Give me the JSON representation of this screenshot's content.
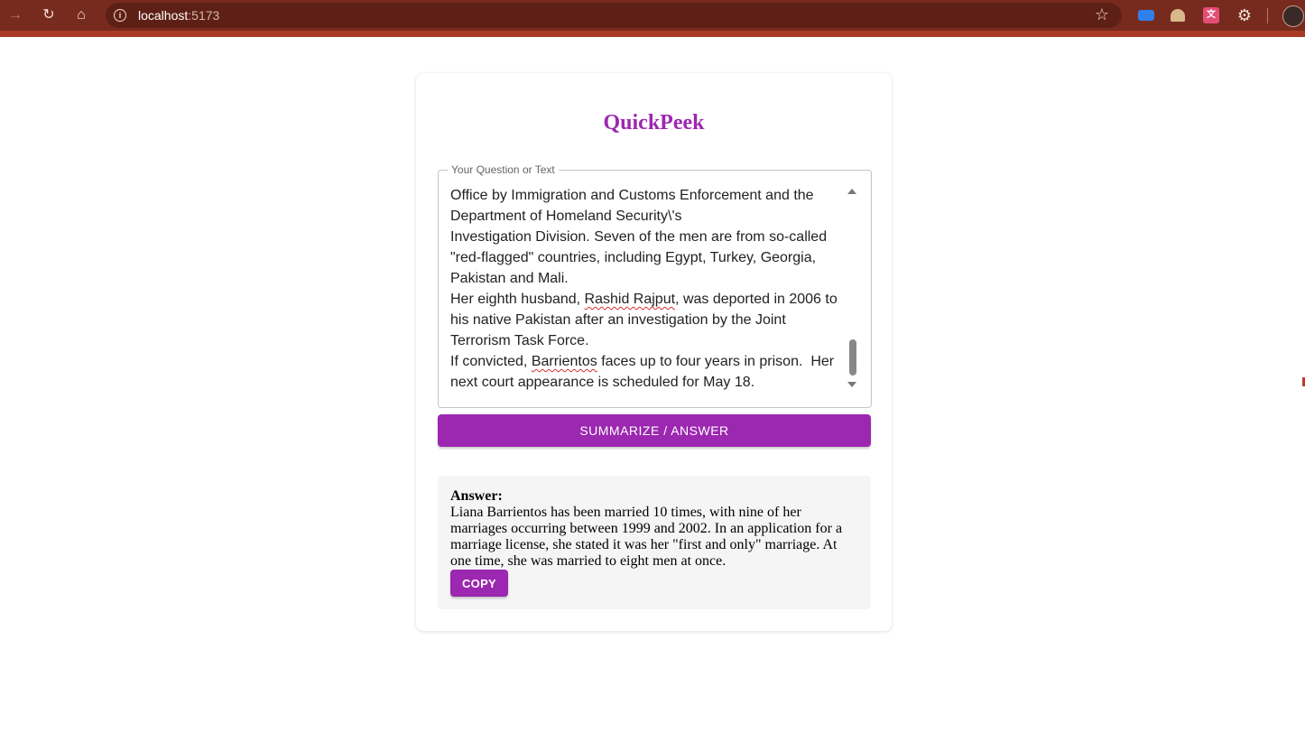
{
  "browser": {
    "url_host": "localhost",
    "url_port": ":5173",
    "icons": [
      "forward-icon",
      "reload-icon",
      "home-icon",
      "info-icon",
      "star-icon",
      "extension-icon",
      "puzzle-icon",
      "profile-avatar"
    ],
    "colors": {
      "toolbar": "#772b1e",
      "omnibox": "#5e2016"
    }
  },
  "app": {
    "title": "QuickPeek",
    "accent_color": "#9c27b0",
    "input": {
      "label": "Your Question or Text",
      "lines": [
        "Office by Immigration and Customs Enforcement and the",
        "Department of Homeland Security\\'s",
        "Investigation Division. Seven of the men are from so-called",
        "\"red-flagged\" countries, including Egypt, Turkey, Georgia,",
        "Pakistan and Mali.",
        "Her eighth husband, ",
        "Rashid Rajput",
        ", was deported in 2006 to",
        "his native Pakistan after an investigation by the Joint",
        "Terrorism Task Force.",
        "If convicted, ",
        "Barrientos",
        " faces up to four years in prison.  Her",
        "next court appearance is scheduled for May 18."
      ]
    },
    "submit_label": "SUMMARIZE / ANSWER",
    "answer": {
      "label": "Answer:",
      "text": "Liana Barrientos has been married 10 times, with nine of her marriages occurring between 1999 and 2002. In an application for a marriage license, she stated it was her \"first and only\" marriage. At one time, she was married to eight men at once.",
      "copy_label": "COPY"
    }
  }
}
